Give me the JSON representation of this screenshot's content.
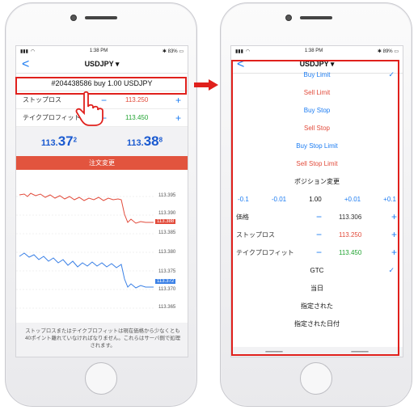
{
  "colors": {
    "accent": "#1c7cf2",
    "sell": "#e24b3b",
    "buy_green": "#23a433",
    "highlight": "#e0201c",
    "modify_bg": "#e2543e"
  },
  "left": {
    "status": {
      "time": "1:38 PM",
      "battery": "83%"
    },
    "nav": {
      "back": "<",
      "title": "USDJPY ▾"
    },
    "order_id": "#204438586 buy 1.00 USDJPY",
    "stop_loss": {
      "label": "ストップロス",
      "minus": "−",
      "value": "113.250",
      "plus": "+"
    },
    "take_profit": {
      "label": "テイクプロフィット",
      "minus": "−",
      "value": "113.450",
      "plus": "+"
    },
    "bid": {
      "main": "113.",
      "big": "37",
      "sup": "2"
    },
    "ask": {
      "main": "113.",
      "big": "38",
      "sup": "8"
    },
    "modify_button": "注文変更",
    "chart_labels": [
      "113.395",
      "113.390",
      "113.388",
      "113.385",
      "113.380",
      "113.375",
      "113.372",
      "113.370",
      "113.365"
    ],
    "footnote": "ストップロスまたはテイクプロフィットは現在価格から少なくとも40ポイント離れていなければなりません。これらはサーバ側で処理されます。"
  },
  "right": {
    "status": {
      "time": "1:38 PM",
      "battery": "89%"
    },
    "nav": {
      "back": "<",
      "title": "USDJPY ▾"
    },
    "order_types": [
      {
        "label": "Buy Limit",
        "color": "blue",
        "checked": true
      },
      {
        "label": "Sell Limit",
        "color": "red",
        "checked": false
      },
      {
        "label": "Buy Stop",
        "color": "blue",
        "checked": false
      },
      {
        "label": "Sell Stop",
        "color": "red",
        "checked": false
      },
      {
        "label": "Buy Stop Limit",
        "color": "blue",
        "checked": false
      },
      {
        "label": "Sell Stop Limit",
        "color": "red",
        "checked": false
      }
    ],
    "modify_position": "ポジション変更",
    "steps": [
      "-0.1",
      "-0.01",
      "1.00",
      "+0.01",
      "+0.1"
    ],
    "price": {
      "label": "価格",
      "minus": "−",
      "value": "113.306",
      "plus": "+"
    },
    "stop_loss": {
      "label": "ストップロス",
      "minus": "−",
      "value": "113.250",
      "plus": "+"
    },
    "take_profit": {
      "label": "テイクプロフィット",
      "minus": "−",
      "value": "113.450",
      "plus": "+"
    },
    "expiry": [
      {
        "label": "GTC",
        "checked": true
      },
      {
        "label": "当日",
        "checked": false
      },
      {
        "label": "指定された",
        "checked": false
      },
      {
        "label": "指定された日付",
        "checked": false
      }
    ]
  }
}
